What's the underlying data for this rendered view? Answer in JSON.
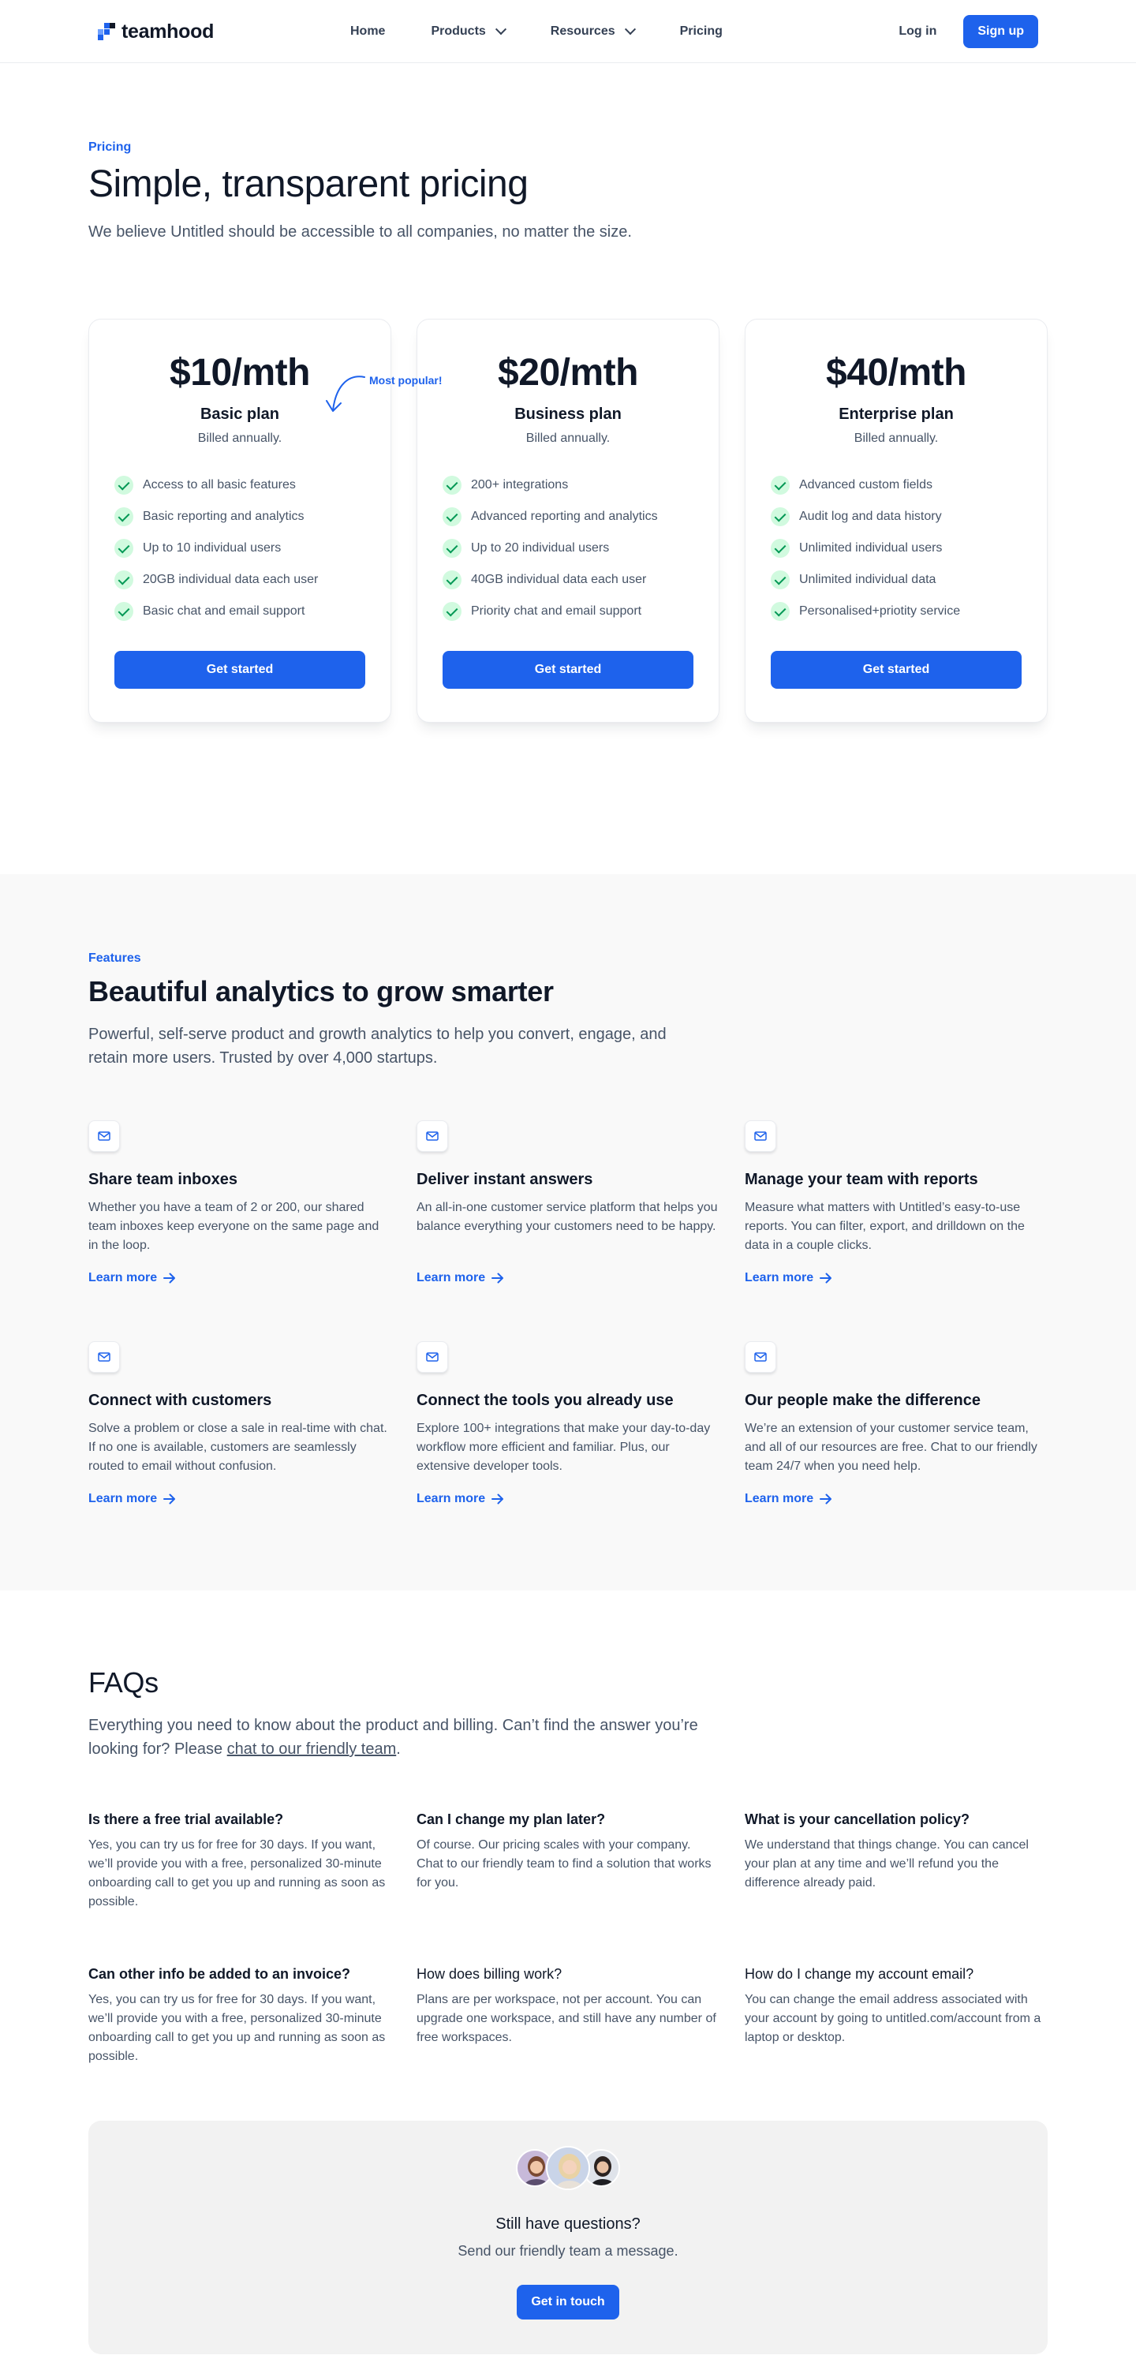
{
  "nav": {
    "logo_text": "teamhood",
    "items": [
      {
        "label": "Home",
        "dropdown": false
      },
      {
        "label": "Products",
        "dropdown": true
      },
      {
        "label": "Resources",
        "dropdown": true
      },
      {
        "label": "Pricing",
        "dropdown": false
      }
    ],
    "login_label": "Log in",
    "signup_label": "Sign up"
  },
  "pricing": {
    "eyebrow": "Pricing",
    "title": "Simple, transparent pricing",
    "subtitle": "We believe Untitled should be accessible to all companies, no matter the size.",
    "popular_label": "Most popular!",
    "plans": [
      {
        "price": "$10/mth",
        "name": "Basic plan",
        "billing": "Billed annually.",
        "features": [
          "Access to all basic features",
          "Basic reporting and analytics",
          "Up to 10 individual users",
          "20GB individual data each user",
          "Basic chat and email support"
        ],
        "cta": "Get started"
      },
      {
        "price": "$20/mth",
        "name": "Business plan",
        "billing": "Billed annually.",
        "features": [
          "200+ integrations",
          "Advanced reporting and analytics",
          "Up to 20 individual users",
          "40GB individual data each user",
          "Priority chat and email support"
        ],
        "cta": "Get started"
      },
      {
        "price": "$40/mth",
        "name": "Enterprise plan",
        "billing": "Billed annually.",
        "features": [
          "Advanced custom fields",
          "Audit log and data history",
          "Unlimited individual users",
          "Unlimited individual data",
          "Personalised+priotity service"
        ],
        "cta": "Get started"
      }
    ]
  },
  "features": {
    "eyebrow": "Features",
    "title": "Beautiful analytics to grow smarter",
    "subtitle": "Powerful, self-serve product and growth analytics to help you convert, engage, and retain more users. Trusted by over 4,000 startups.",
    "learn_more": "Learn more",
    "items": [
      {
        "title": "Share team inboxes",
        "desc": "Whether you have a team of 2 or 200, our shared team inboxes keep everyone on the same page and in the loop."
      },
      {
        "title": "Deliver instant answers",
        "desc": "An all-in-one customer service platform that helps you balance everything your customers need to be happy."
      },
      {
        "title": "Manage your team with reports",
        "desc": "Measure what matters with Untitled’s easy-to-use reports. You can filter, export, and drilldown on the data in a couple clicks."
      },
      {
        "title": "Connect with customers",
        "desc": "Solve a problem or close a sale in real-time with chat. If no one is available, customers are seamlessly routed to email without confusion."
      },
      {
        "title": "Connect the tools you already use",
        "desc": "Explore 100+ integrations that make your day-to-day workflow more efficient and familiar. Plus, our extensive developer tools."
      },
      {
        "title": "Our people make the difference",
        "desc": "We’re an extension of your customer service team, and all of our resources are free. Chat to our friendly team 24/7 when you need help."
      }
    ]
  },
  "faq": {
    "title": "FAQs",
    "subtitle_before": "Everything you need to know about the product and billing. Can’t find the answer you’re looking for? Please ",
    "subtitle_link": "chat to our friendly team",
    "subtitle_after": ".",
    "items": [
      {
        "q": "Is there a free trial available?",
        "a": "Yes, you can try us for free for 30 days. If you want, we’ll provide you with a free, personalized 30-minute onboarding call to get you up and running as soon as possible."
      },
      {
        "q": "Can I change my plan later?",
        "a": "Of course. Our pricing scales with your company. Chat to our friendly team to find a solution that works for you."
      },
      {
        "q": "What is your cancellation policy?",
        "a": "We understand that things change. You can cancel your plan at any time and we’ll refund you the difference already paid."
      },
      {
        "q": "Can other info be added to an invoice?",
        "a": "Yes, you can try us for free for 30 days. If you want, we’ll provide you with a free, personalized 30-minute onboarding call to get you up and running as soon as possible."
      },
      {
        "q": "How does billing work?",
        "a": "Plans are per workspace, not per account. You can upgrade one workspace, and still have any number of free workspaces."
      },
      {
        "q": "How do I change my account email?",
        "a": "You can change the email address associated with your account by going to untitled.com/account from a laptop or desktop."
      }
    ],
    "contact": {
      "title": "Still have questions?",
      "subtitle": "Send our friendly team a message.",
      "button": "Get in touch"
    }
  },
  "colors": {
    "accent": "#1e62ec",
    "check_bg": "#d1fadf",
    "check": "#039855",
    "section_bg": "#f9f9f9"
  },
  "icons": [
    "chevron-down-icon",
    "check-icon",
    "mail-icon",
    "arrow-right-icon",
    "curved-arrow-icon"
  ]
}
